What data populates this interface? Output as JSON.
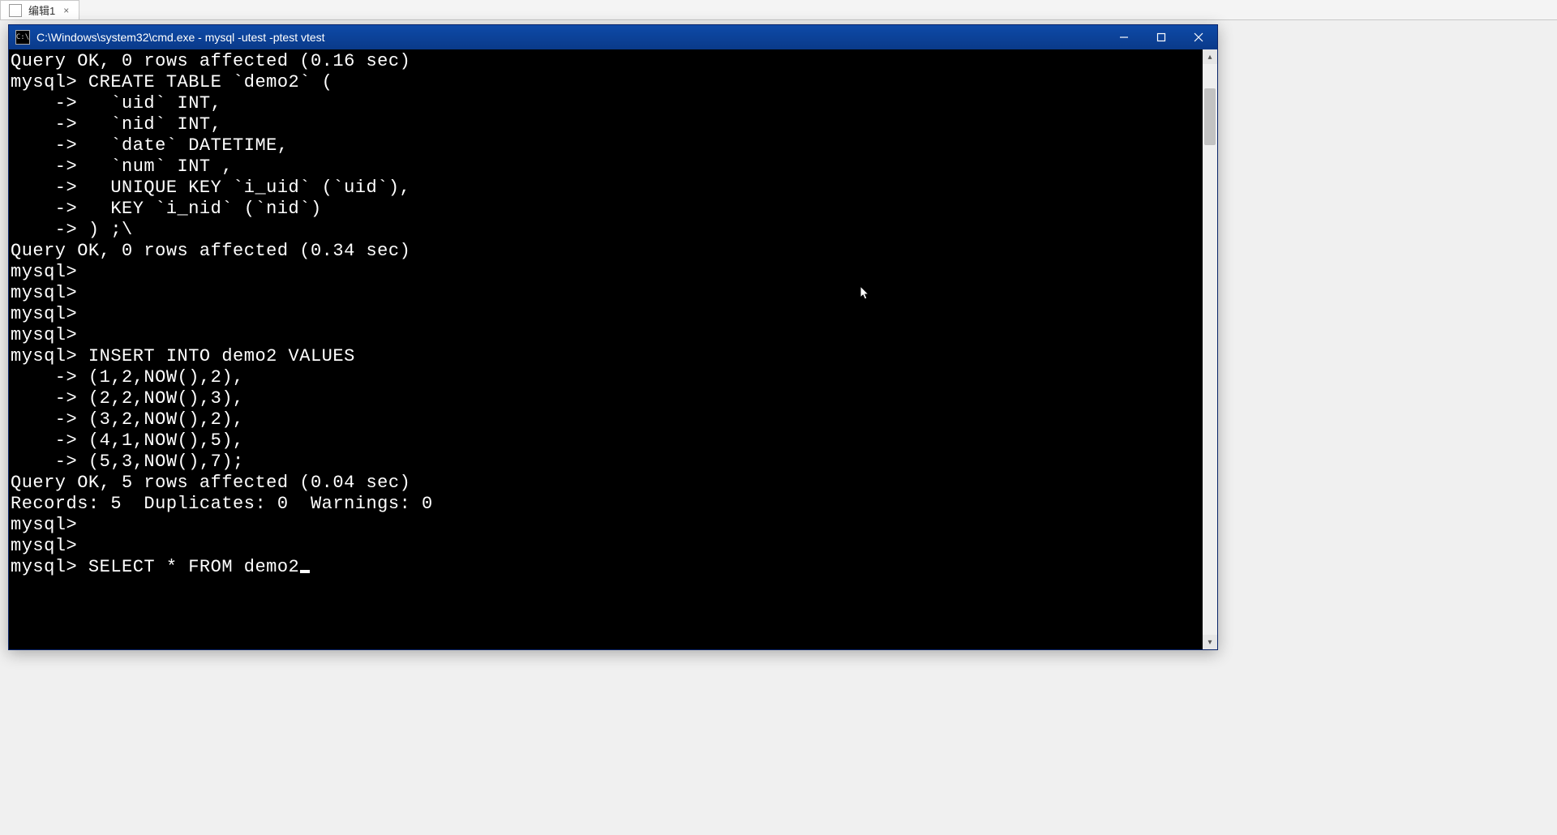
{
  "outer_tab": {
    "label": "编辑1",
    "close_glyph": "×"
  },
  "window": {
    "title": "C:\\Windows\\system32\\cmd.exe - mysql  -utest -ptest vtest",
    "icon_text": "C:\\"
  },
  "terminal": {
    "lines": [
      "Query OK, 0 rows affected (0.16 sec)",
      "",
      "mysql> CREATE TABLE `demo2` (",
      "    ->   `uid` INT,",
      "    ->   `nid` INT,",
      "    ->   `date` DATETIME,",
      "    ->   `num` INT ,",
      "    ->   UNIQUE KEY `i_uid` (`uid`),",
      "    ->   KEY `i_nid` (`nid`)",
      "    -> ) ;\\",
      "Query OK, 0 rows affected (0.34 sec)",
      "",
      "mysql>",
      "mysql>",
      "mysql>",
      "mysql>",
      "mysql> INSERT INTO demo2 VALUES",
      "    -> (1,2,NOW(),2),",
      "    -> (2,2,NOW(),3),",
      "    -> (3,2,NOW(),2),",
      "    -> (4,1,NOW(),5),",
      "    -> (5,3,NOW(),7);",
      "Query OK, 5 rows affected (0.04 sec)",
      "Records: 5  Duplicates: 0  Warnings: 0",
      "",
      "mysql>",
      "mysql>",
      "mysql> SELECT * FROM demo2"
    ]
  }
}
